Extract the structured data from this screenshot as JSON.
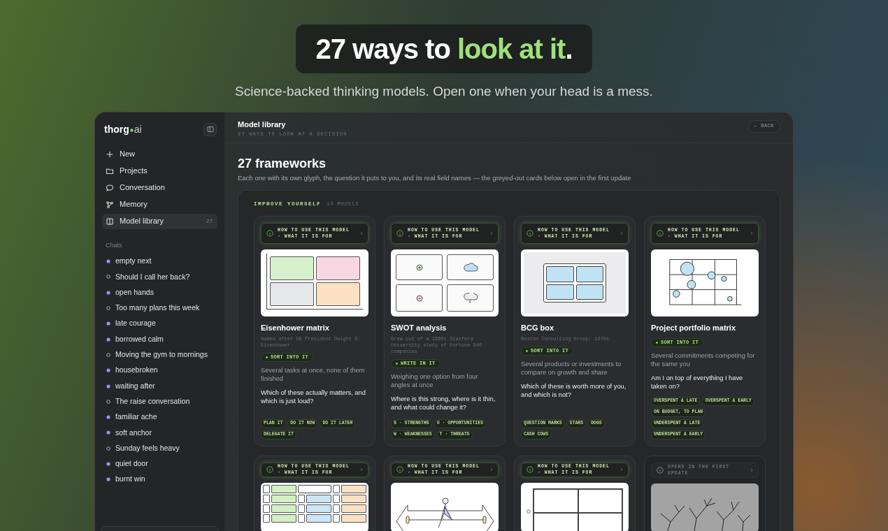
{
  "hero": {
    "headline": [
      {
        "text": "27 ways to ",
        "accent": false
      },
      {
        "text": "look at it",
        "accent": true
      },
      {
        "text": ".",
        "accent": false
      }
    ],
    "subtitle": "Science-backed thinking models. Open one when your head is a mess."
  },
  "sidebar": {
    "logo": {
      "name": "thorg",
      "suffix": "ai"
    },
    "nav": [
      {
        "label": "New",
        "selected": false
      },
      {
        "label": "Projects",
        "selected": false
      },
      {
        "label": "Conversation",
        "selected": false
      },
      {
        "label": "Memory",
        "selected": false
      },
      {
        "label": "Model library",
        "selected": true,
        "count": "27"
      }
    ],
    "chats_heading": "Chats",
    "chats": [
      {
        "label": "empty next",
        "kind": "filled"
      },
      {
        "label": "Should I call her back?",
        "kind": "hollow"
      },
      {
        "label": "open hands",
        "kind": "filled"
      },
      {
        "label": "Too many plans this week",
        "kind": "hollow"
      },
      {
        "label": "late courage",
        "kind": "filled"
      },
      {
        "label": "borrowed calm",
        "kind": "filled"
      },
      {
        "label": "Moving the gym to mornings",
        "kind": "hollow"
      },
      {
        "label": "housebroken",
        "kind": "filled"
      },
      {
        "label": "waiting after",
        "kind": "filled"
      },
      {
        "label": "The raise conversation",
        "kind": "hollow"
      },
      {
        "label": "familiar ache",
        "kind": "filled"
      },
      {
        "label": "soft anchor",
        "kind": "filled"
      },
      {
        "label": "Sunday feels heavy",
        "kind": "hollow"
      },
      {
        "label": "quiet door",
        "kind": "filled"
      },
      {
        "label": "burnt win",
        "kind": "filled"
      }
    ]
  },
  "header": {
    "title": "Model library",
    "subtitle": "27 WAYS TO LOOK AT A DECISION",
    "back_button": "← BACK"
  },
  "intro": {
    "heading": "27 frameworks",
    "description": "Each one with its own glyph, the question it puts to you, and its real field names — the greyed-out cards below open in the first update"
  },
  "section": {
    "title": "IMPROVE YOURSELF",
    "count": "14 MODELS",
    "cards": [
      {
        "how_to": "HOW TO USE THIS MODEL · WHAT IT IS FOR",
        "disabled": false,
        "diagram": {
          "kind": "matrix",
          "cells": [
            {
              "color": "#d6f0cb"
            },
            {
              "color": "#f8d6e2"
            },
            {
              "color": "#e6e7ea"
            },
            {
              "color": "#fde0c2"
            }
          ]
        },
        "title": "Eisenhower matrix",
        "origin": "Named after US President Dwight D. Eisenhower",
        "action": "SORT INTO IT",
        "situation": "Several tasks at once, none of them finished",
        "question": "Which of these actually matters, and which is just loud?",
        "tags": [
          "PLAN IT",
          "DO IT NOW",
          "DO IT LATER",
          "DELEGATE IT"
        ]
      },
      {
        "how_to": "HOW TO USE THIS MODEL · WHAT IT IS FOR",
        "disabled": false,
        "diagram": {
          "kind": "swot"
        },
        "title": "SWOT analysis",
        "origin": "Grew out of a 1960s Stanford University study of Fortune 500 companies",
        "action": "WRITE IN IT",
        "situation": "Weighing one option from four angles at once",
        "question": "Where is this strong, where is it thin, and what could change it?",
        "tags": [
          "S · STRENGTHS",
          "O · OPPORTUNITIES",
          "W · WEAKNESSES",
          "T · THREATS"
        ]
      },
      {
        "how_to": "HOW TO USE THIS MODEL · WHAT IT IS FOR",
        "disabled": false,
        "diagram": {
          "kind": "bcg"
        },
        "title": "BCG box",
        "origin": "Boston Consulting Group, 1970s",
        "action": "SORT INTO IT",
        "situation": "Several products or investments to compare on growth and share",
        "question": "Which of these is worth more of you, and which is not?",
        "tags": [
          "QUESTION MARKS",
          "STARS",
          "DOGS",
          "CASH COWS"
        ]
      },
      {
        "how_to": "HOW TO USE THIS MODEL · WHAT IT IS FOR",
        "disabled": false,
        "diagram": {
          "kind": "portfolio"
        },
        "title": "Project portfolio matrix",
        "action": "SORT INTO IT",
        "situation": "Several commitments competing for the same you",
        "question": "Am I on top of everything I have taken on?",
        "tags": [
          "OVERSPENT & LATE",
          "OVERSPENT & EARLY",
          "ON BUDGET, TO PLAN",
          "UNDERSPENT & LATE",
          "UNDERSPENT & EARLY"
        ]
      },
      {
        "how_to": "HOW TO USE THIS MODEL · WHAT IT IS FOR",
        "disabled": false,
        "diagram": {
          "kind": "smart",
          "groups": [
            {
              "color": "#d3efc4"
            },
            {
              "color": "#cde5f7"
            },
            {
              "color": "#fde1c5"
            }
          ]
        }
      },
      {
        "how_to": "HOW TO USE THIS MODEL · WHAT IT IS FOR",
        "disabled": false,
        "diagram": {
          "kind": "force"
        }
      },
      {
        "how_to": "HOW TO USE THIS MODEL · WHAT IT IS FOR",
        "disabled": false,
        "diagram": {
          "kind": "feedback"
        }
      },
      {
        "how_to": "OPENS IN THE FIRST UPDATE",
        "disabled": true,
        "diagram": {
          "kind": "tree"
        }
      }
    ]
  }
}
